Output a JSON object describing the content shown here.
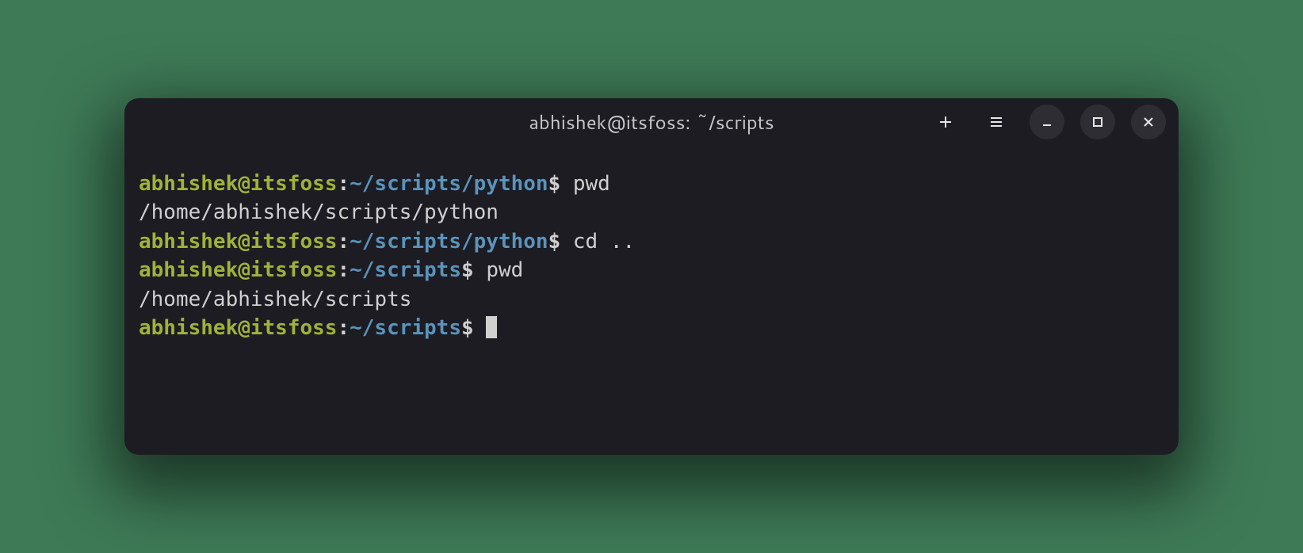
{
  "window": {
    "title": "abhishek@itsfoss: ~/scripts"
  },
  "lines": [
    {
      "type": "prompt",
      "user_host": "abhishek@itsfoss",
      "colon": ":",
      "path": "~/scripts/python",
      "dollar": "$ ",
      "command": "pwd"
    },
    {
      "type": "output",
      "text": "/home/abhishek/scripts/python"
    },
    {
      "type": "prompt",
      "user_host": "abhishek@itsfoss",
      "colon": ":",
      "path": "~/scripts/python",
      "dollar": "$ ",
      "command": "cd .."
    },
    {
      "type": "prompt",
      "user_host": "abhishek@itsfoss",
      "colon": ":",
      "path": "~/scripts",
      "dollar": "$ ",
      "command": "pwd"
    },
    {
      "type": "output",
      "text": "/home/abhishek/scripts"
    },
    {
      "type": "prompt",
      "user_host": "abhishek@itsfoss",
      "colon": ":",
      "path": "~/scripts",
      "dollar": "$ ",
      "command": "",
      "cursor": true
    }
  ]
}
